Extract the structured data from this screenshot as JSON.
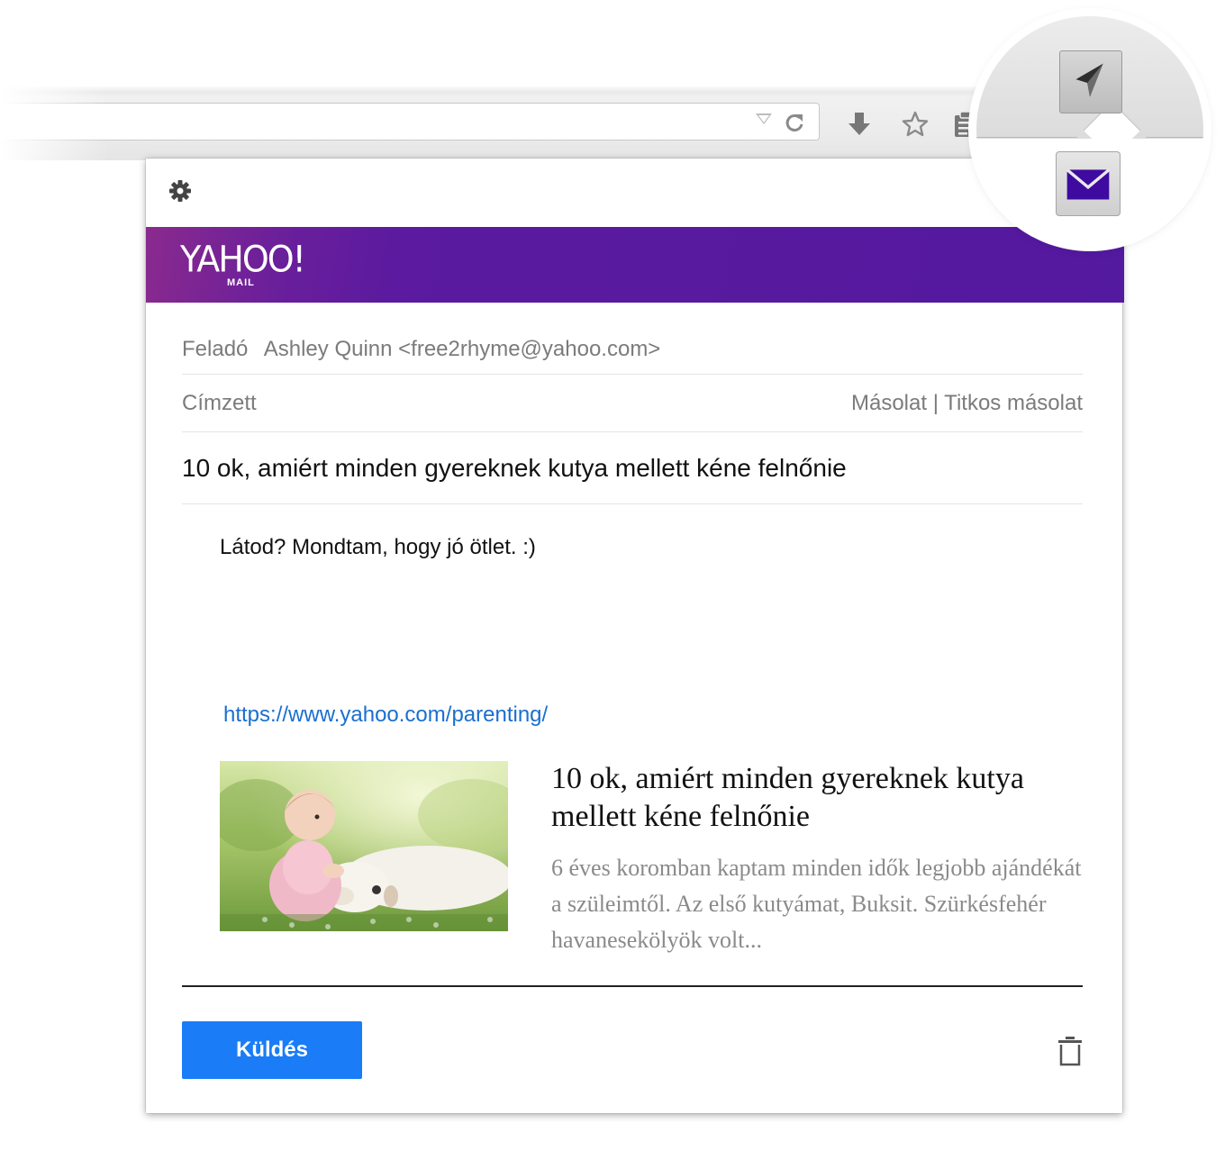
{
  "compose": {
    "from_label": "Feladó",
    "from_value": "Ashley Quinn <free2rhyme@yahoo.com>",
    "to_label": "Címzett",
    "cc_label": "Másolat",
    "separator": "|",
    "bcc_label": "Titkos másolat",
    "subject": "10 ok, amiért minden gyereknek kutya mellett kéne felnőnie",
    "body": "Látod? Mondtam, hogy jó ötlet. :)",
    "link": "https://www.yahoo.com/parenting/"
  },
  "brand": {
    "logo_text": "YAHOO!",
    "logo_sub": "MAIL",
    "banner_color": "#53199f"
  },
  "card": {
    "title": "10 ok, amiért minden gyereknek kutya mellett kéne felnőnie",
    "description": "6 éves koromban kaptam minden idők legjobb ajándékát a szüleimtől. Az első kutyámat, Buksit. Szürkésfehér havanesekölyök volt..."
  },
  "actions": {
    "send_label": "Küldés",
    "send_color": "#1a7cf6"
  },
  "icons": {
    "settings": "gear-icon",
    "trash": "trash-icon",
    "download": "download-icon",
    "bookmark": "star-icon",
    "clipboard": "clipboard-icon",
    "reload": "reload-icon",
    "send_extension": "paper-plane-icon",
    "mail_extension": "envelope-icon"
  }
}
